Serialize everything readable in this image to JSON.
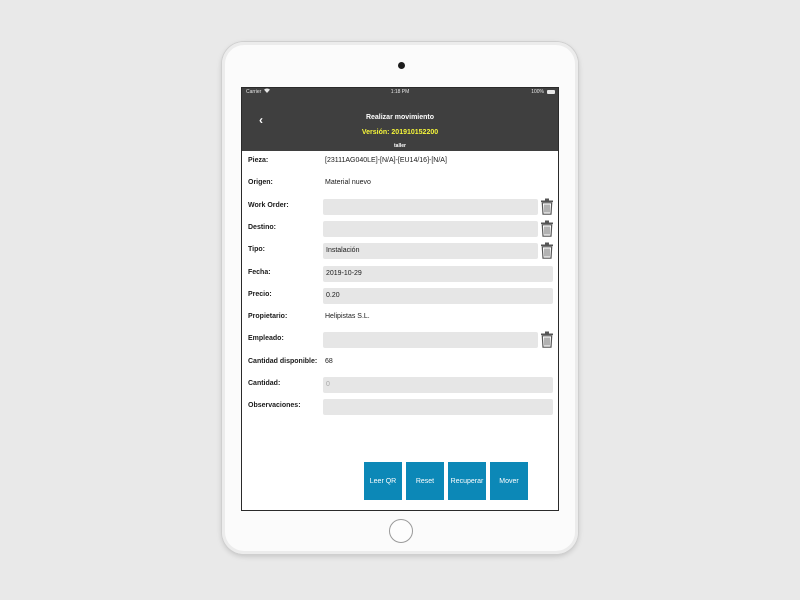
{
  "status_bar": {
    "carrier": "Carrier",
    "time": "1:18 PM",
    "battery": "100%"
  },
  "nav": {
    "back_icon": "chevron-left-icon",
    "title": "Realizar movimiento",
    "version": "Versión: 201910152200",
    "subtitle": "taller",
    "version_color": "#f5f53a",
    "bar_color": "#3f3f3f"
  },
  "form": {
    "pieza": {
      "label": "Pieza:",
      "value": "[23111AG040LE]-[N/A]-[EU14/16]-[N/A]"
    },
    "origen": {
      "label": "Origen:",
      "value": "Material nuevo"
    },
    "work_order": {
      "label": "Work Order:",
      "value": ""
    },
    "destino": {
      "label": "Destino:",
      "value": ""
    },
    "tipo": {
      "label": "Tipo:",
      "value": "Instalación"
    },
    "fecha": {
      "label": "Fecha:",
      "value": "2019-10-29"
    },
    "precio": {
      "label": "Precio:",
      "value": "0.20"
    },
    "propietario": {
      "label": "Propietario:",
      "value": "Helipistas S.L."
    },
    "empleado": {
      "label": "Empleado:",
      "value": ""
    },
    "cantidad_disponible": {
      "label": "Cantidad disponible:",
      "value": "68"
    },
    "cantidad": {
      "label": "Cantidad:",
      "value": "",
      "placeholder": "0"
    },
    "observaciones": {
      "label": "Observaciones:",
      "value": ""
    }
  },
  "trash_icon": "trash-icon",
  "buttons": {
    "leer_qr": "Leer QR",
    "reset": "Reset",
    "recuperar": "Recuperar",
    "mover": "Mover",
    "color": "#0c88b7"
  }
}
